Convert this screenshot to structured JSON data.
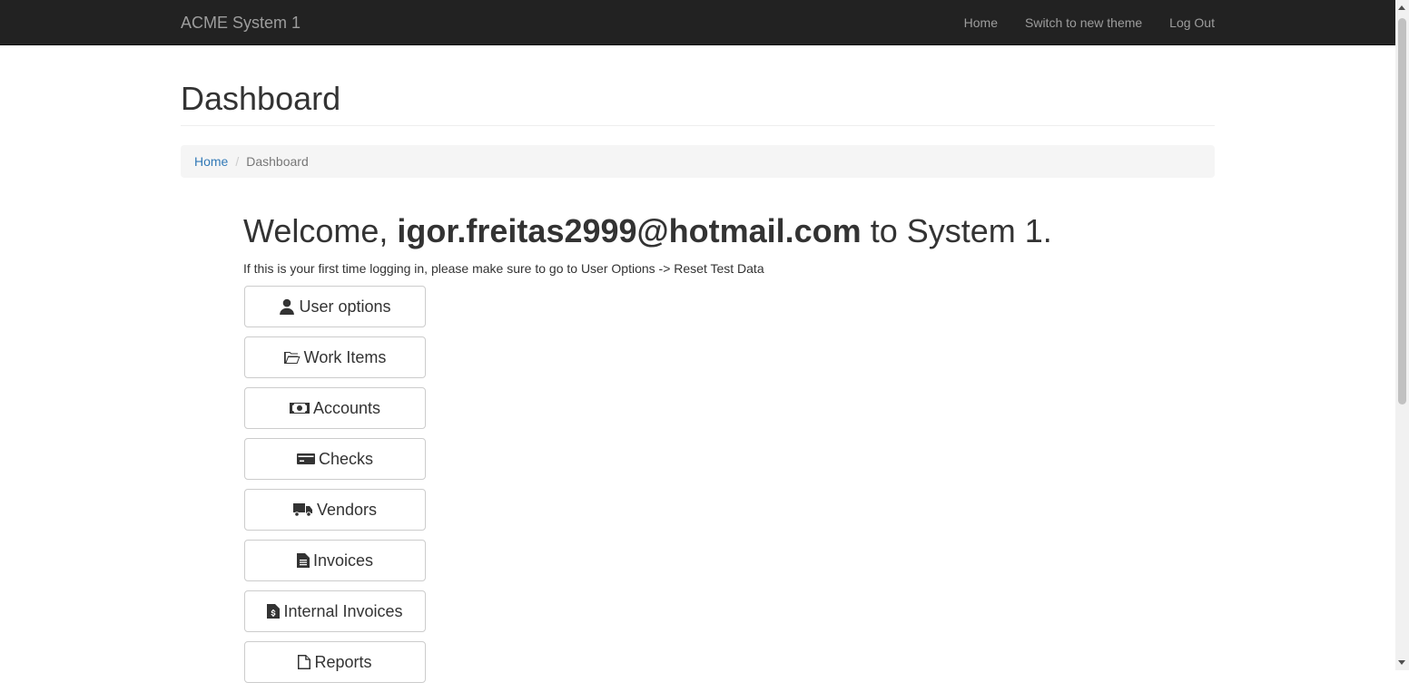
{
  "navbar": {
    "brand": "ACME System 1",
    "links": [
      "Home",
      "Switch to new theme",
      "Log Out"
    ]
  },
  "page": {
    "title": "Dashboard"
  },
  "breadcrumb": {
    "home": "Home",
    "separator": "/",
    "current": "Dashboard"
  },
  "welcome": {
    "prefix": "Welcome,",
    "user": "igor.freitas2999@hotmail.com",
    "suffix": "to System 1.",
    "notice": "If this is your first time logging in, please make sure to go to User Options -> Reset Test Data"
  },
  "menu": [
    {
      "label": "User options",
      "icon": "user-icon"
    },
    {
      "label": "Work Items",
      "icon": "folder-open-icon"
    },
    {
      "label": "Accounts",
      "icon": "money-icon"
    },
    {
      "label": "Checks",
      "icon": "credit-card-icon"
    },
    {
      "label": "Vendors",
      "icon": "truck-icon"
    },
    {
      "label": "Invoices",
      "icon": "file-text-icon"
    },
    {
      "label": "Internal Invoices",
      "icon": "file-invoice-dollar-icon"
    },
    {
      "label": "Reports",
      "icon": "file-icon"
    }
  ],
  "colors": {
    "navbar_bg": "#222222",
    "navbar_text": "#9d9d9d",
    "link": "#337ab7",
    "breadcrumb_bg": "#f5f5f5"
  }
}
